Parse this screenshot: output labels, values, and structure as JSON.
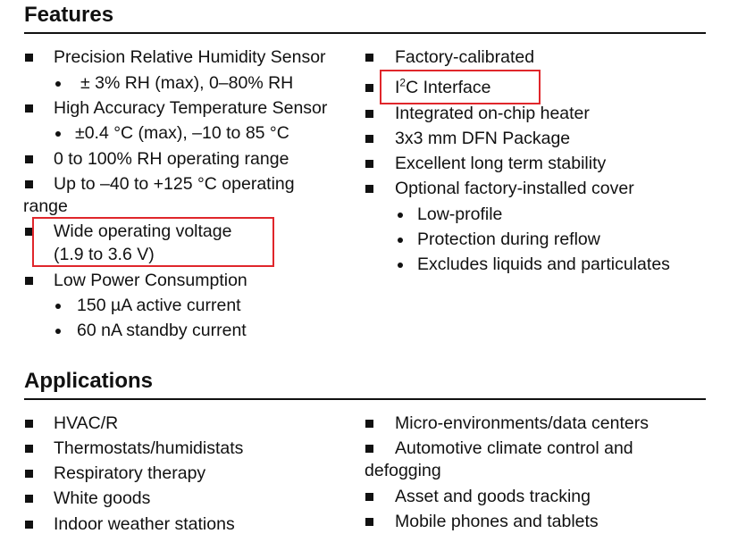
{
  "features": {
    "heading": "Features",
    "left": [
      "Precision Relative Humidity Sensor",
      "± 3% RH (max), 0–80% RH",
      "High Accuracy Temperature Sensor",
      "±0.4 °C (max), –10 to 85 °C",
      "0 to 100% RH operating range",
      "Up to –40 to +125 °C operating",
      "range",
      "Wide operating voltage",
      "(1.9 to 3.6 V)",
      "Low Power Consumption",
      "150 µA active current",
      "60 nA standby current"
    ],
    "right": {
      "factory": "Factory-calibrated",
      "i2c_prefix": "I",
      "i2c_sup": "2",
      "i2c_suffix": "C Interface",
      "heater": "Integrated on-chip heater",
      "package": "3x3 mm DFN Package",
      "stability": "Excellent long term stability",
      "cover": "Optional factory-installed cover",
      "sub": [
        "Low-profile",
        "Protection during reflow",
        "Excludes liquids and particulates"
      ]
    }
  },
  "applications": {
    "heading": "Applications",
    "left": [
      "HVAC/R",
      "Thermostats/humidistats",
      "Respiratory therapy",
      "White goods",
      "Indoor weather stations"
    ],
    "right": [
      "Micro-environments/data centers",
      "Automotive climate control and",
      "defogging",
      "Asset and goods tracking",
      "Mobile phones and tablets"
    ]
  },
  "highlight_color": "#e0262b"
}
